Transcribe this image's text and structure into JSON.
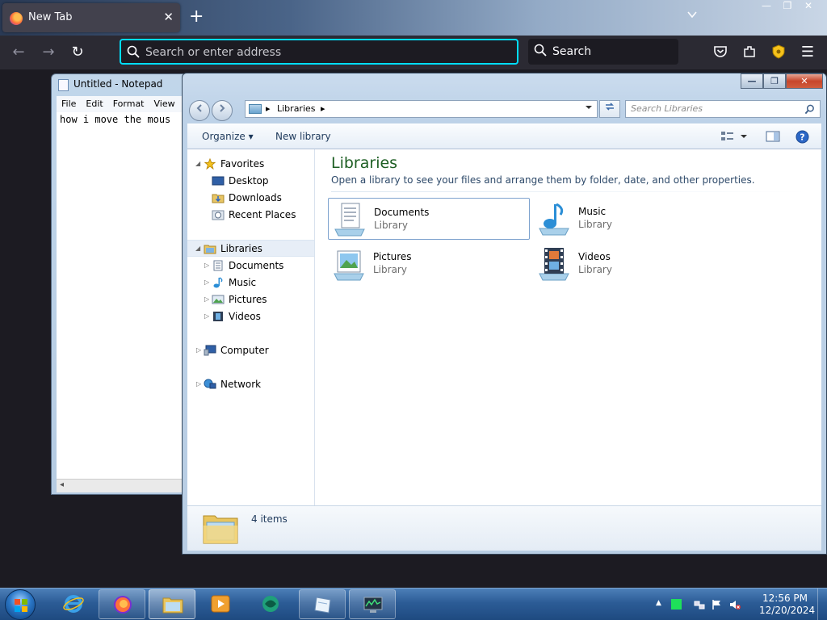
{
  "firefox": {
    "tab_title": "New Tab",
    "tab_close": "✕",
    "new_tab": "+",
    "url_placeholder": "Search or enter address",
    "search_label": "Search",
    "window_controls": [
      "—",
      "❐",
      "✕"
    ],
    "nav": {
      "back": "←",
      "forward": "→",
      "reload": "↻",
      "menu": "☰"
    },
    "icons": [
      "firefox-icon",
      "pocket-icon",
      "extensions-icon",
      "ublock-shield-icon",
      "hamburger-menu-icon"
    ]
  },
  "notepad": {
    "title": "Untitled - Notepad",
    "menu": [
      "File",
      "Edit",
      "Format",
      "View"
    ],
    "content": "how i move the mous",
    "scroll_arrow": "◂"
  },
  "explorer": {
    "window_controls": {
      "minimize": "—",
      "maximize": "❐",
      "close": "✕"
    },
    "breadcrumb": [
      "Libraries"
    ],
    "separators": [
      "▸",
      "▸"
    ],
    "search_placeholder": "Search Libraries",
    "toolbar": {
      "organize": "Organize ▾",
      "new_library": "New library"
    },
    "nav_tree": {
      "favorites": {
        "label": "Favorites",
        "items": [
          "Desktop",
          "Downloads",
          "Recent Places"
        ]
      },
      "libraries": {
        "label": "Libraries",
        "items": [
          "Documents",
          "Music",
          "Pictures",
          "Videos"
        ]
      },
      "computer": "Computer",
      "network": "Network"
    },
    "heading": "Libraries",
    "description": "Open a library to see your files and arrange them by folder, date, and other properties.",
    "libraries": [
      {
        "name": "Documents",
        "type": "Library"
      },
      {
        "name": "Music",
        "type": "Library"
      },
      {
        "name": "Pictures",
        "type": "Library"
      },
      {
        "name": "Videos",
        "type": "Library"
      }
    ],
    "details": {
      "count": "4 items"
    }
  },
  "taskbar": {
    "clock_time": "12:56 PM",
    "clock_date": "12/20/2024",
    "apps": [
      "internet-explorer-icon",
      "firefox-icon",
      "explorer-icon",
      "media-player-icon",
      "game-icon",
      "notepad-icon",
      "task-manager-icon"
    ],
    "tray_arrow": "▲"
  },
  "colors": {
    "firefox_tab_bg": "#42414d",
    "firefox_toolbar": "#2b2a33",
    "url_focus_border": "#00ddff",
    "library_heading": "#1e5f24",
    "taskbar_blue": "#2c5c96"
  }
}
